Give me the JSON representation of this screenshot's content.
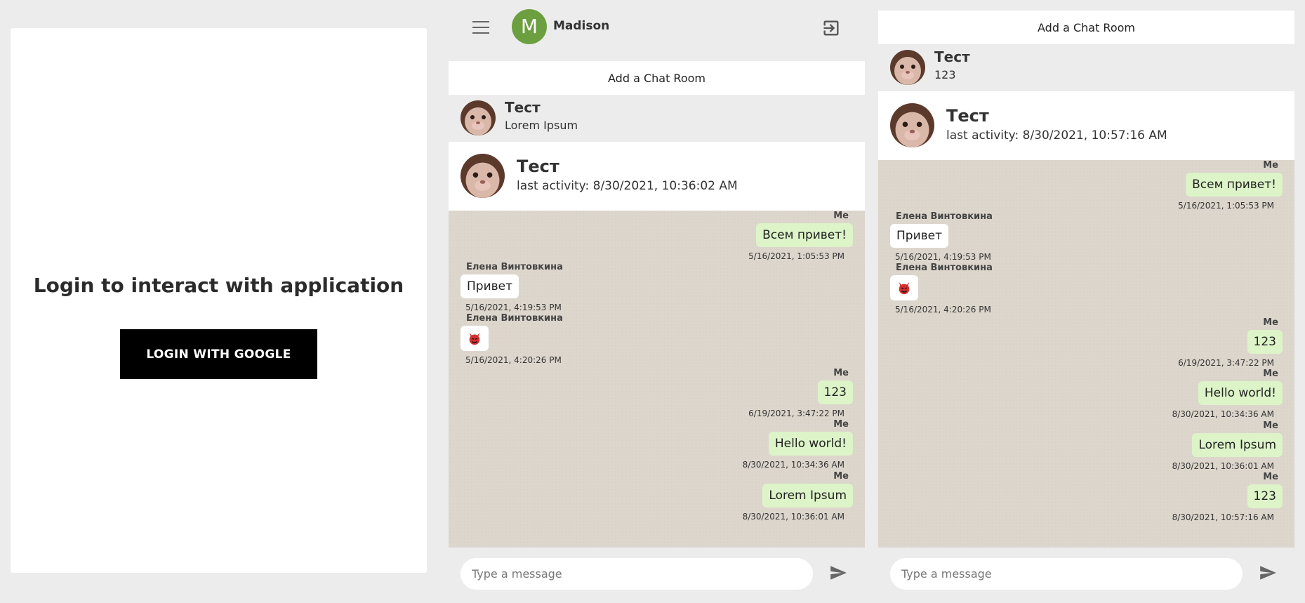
{
  "login": {
    "title": "Login to interact with application",
    "button_label": "LOGIN WITH GOOGLE"
  },
  "chat_a": {
    "user": {
      "initial": "M",
      "name": "Madison",
      "avatar_color": "#6c9f3f"
    },
    "menu_icon": "hamburger-icon",
    "logout_icon": "logout-icon",
    "add_room_label": "Add a Chat Room",
    "rooms": [
      {
        "name": "Тест",
        "last_message": "Lorem Ipsum"
      }
    ],
    "active_room": {
      "name": "Тест",
      "activity": "last activity: 8/30/2021, 10:36:02 AM"
    },
    "messages": [
      {
        "author": "Me",
        "text": "Всем привет!",
        "time": "5/16/2021, 1:05:53 PM"
      },
      {
        "author": "Елена Винтовкина",
        "text": "Привет",
        "time": "5/16/2021, 4:19:53 PM"
      },
      {
        "author": "Елена Винтовкина",
        "text": "",
        "icon": "devil-emoji-icon",
        "time": "5/16/2021, 4:20:26 PM"
      },
      {
        "author": "Me",
        "text": "123",
        "time": "6/19/2021, 3:47:22 PM"
      },
      {
        "author": "Me",
        "text": "Hello world!",
        "time": "8/30/2021, 10:34:36 AM"
      },
      {
        "author": "Me",
        "text": "Lorem Ipsum",
        "time": "8/30/2021, 10:36:01 AM"
      }
    ],
    "composer_placeholder": "Type a message",
    "send_icon": "send-icon"
  },
  "chat_b": {
    "add_room_label": "Add a Chat Room",
    "rooms": [
      {
        "name": "Тест",
        "last_message": "123"
      }
    ],
    "active_room": {
      "name": "Тест",
      "activity": "last activity: 8/30/2021, 10:57:16 AM"
    },
    "messages": [
      {
        "author": "Me",
        "text": "Всем привет!",
        "time": "5/16/2021, 1:05:53 PM"
      },
      {
        "author": "Елена Винтовкина",
        "text": "Привет",
        "time": "5/16/2021, 4:19:53 PM"
      },
      {
        "author": "Елена Винтовкина",
        "text": "",
        "icon": "devil-emoji-icon",
        "time": "5/16/2021, 4:20:26 PM"
      },
      {
        "author": "Me",
        "text": "123",
        "time": "6/19/2021, 3:47:22 PM"
      },
      {
        "author": "Me",
        "text": "Hello world!",
        "time": "8/30/2021, 10:34:36 AM"
      },
      {
        "author": "Me",
        "text": "Lorem Ipsum",
        "time": "8/30/2021, 10:36:01 AM"
      },
      {
        "author": "Me",
        "text": "123",
        "time": "8/30/2021, 10:57:16 AM"
      }
    ],
    "composer_placeholder": "Type a message",
    "send_icon": "send-icon"
  },
  "colors": {
    "sent_bubble": "#dcf4c8",
    "received_bubble": "#ffffff",
    "chat_background": "#ddd6cd",
    "login_button": "#000000"
  }
}
